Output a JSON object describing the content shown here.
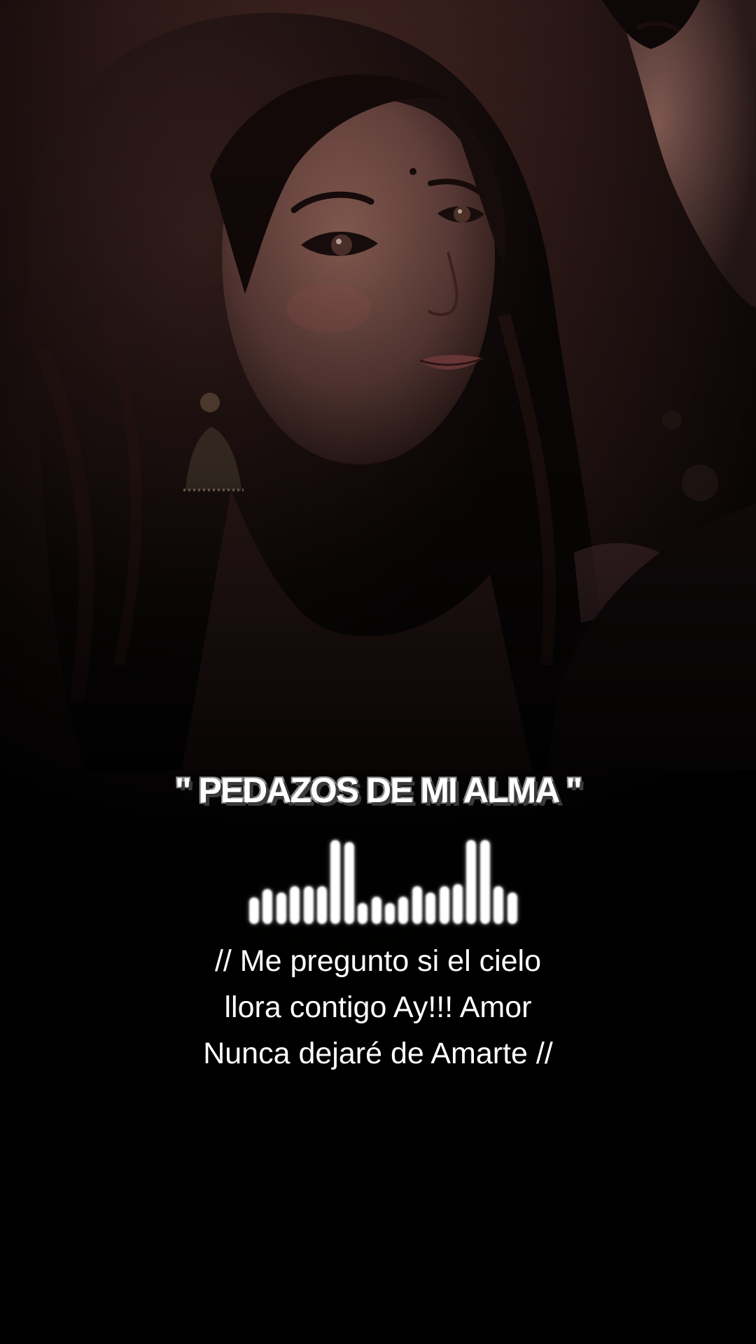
{
  "title": "\" PEDAZOS DE MI ALMA \"",
  "visualizer": {
    "levels": [
      0.25,
      0.33,
      0.3,
      0.36,
      0.36,
      0.36,
      0.8,
      0.78,
      0.2,
      0.26,
      0.2,
      0.26,
      0.36,
      0.3,
      0.36,
      0.38,
      0.8,
      0.8,
      0.36,
      0.3
    ],
    "color": "#ffffff"
  },
  "lyrics": {
    "line1": "// Me pregunto si el cielo",
    "line2": "llora contigo Ay!!! Amor",
    "line3": "Nunca dejaré de Amarte //"
  },
  "colors": {
    "background": "#000000",
    "text": "#ffffff",
    "title_shadow": "#3a3a3a"
  }
}
